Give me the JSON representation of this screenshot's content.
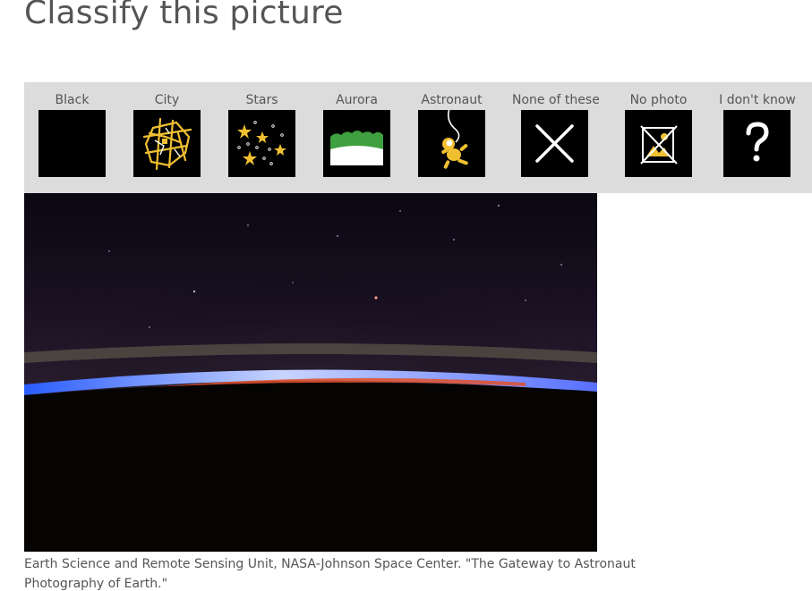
{
  "page": {
    "title": "Classify this picture"
  },
  "choices": [
    {
      "label": "Black",
      "icon": "black-square-icon"
    },
    {
      "label": "City",
      "icon": "city-map-icon"
    },
    {
      "label": "Stars",
      "icon": "stars-icon"
    },
    {
      "label": "Aurora",
      "icon": "aurora-icon"
    },
    {
      "label": "Astronaut",
      "icon": "astronaut-icon"
    },
    {
      "label": "None of these",
      "icon": "cross-icon"
    },
    {
      "label": "No photo",
      "icon": "no-photo-icon"
    },
    {
      "label": "I don't know",
      "icon": "question-mark-icon"
    }
  ],
  "photo": {
    "subject": "earth-limb-at-night"
  },
  "caption": {
    "text": "Earth Science and Remote Sensing Unit, NASA-Johnson Space Center. \"The Gateway to Astronaut Photography of Earth.\""
  },
  "colors": {
    "bar_background": "#dcdcdc",
    "icon_accent": "#f0c030",
    "aurora_green": "#3fa03f",
    "text_gray": "#555555"
  }
}
